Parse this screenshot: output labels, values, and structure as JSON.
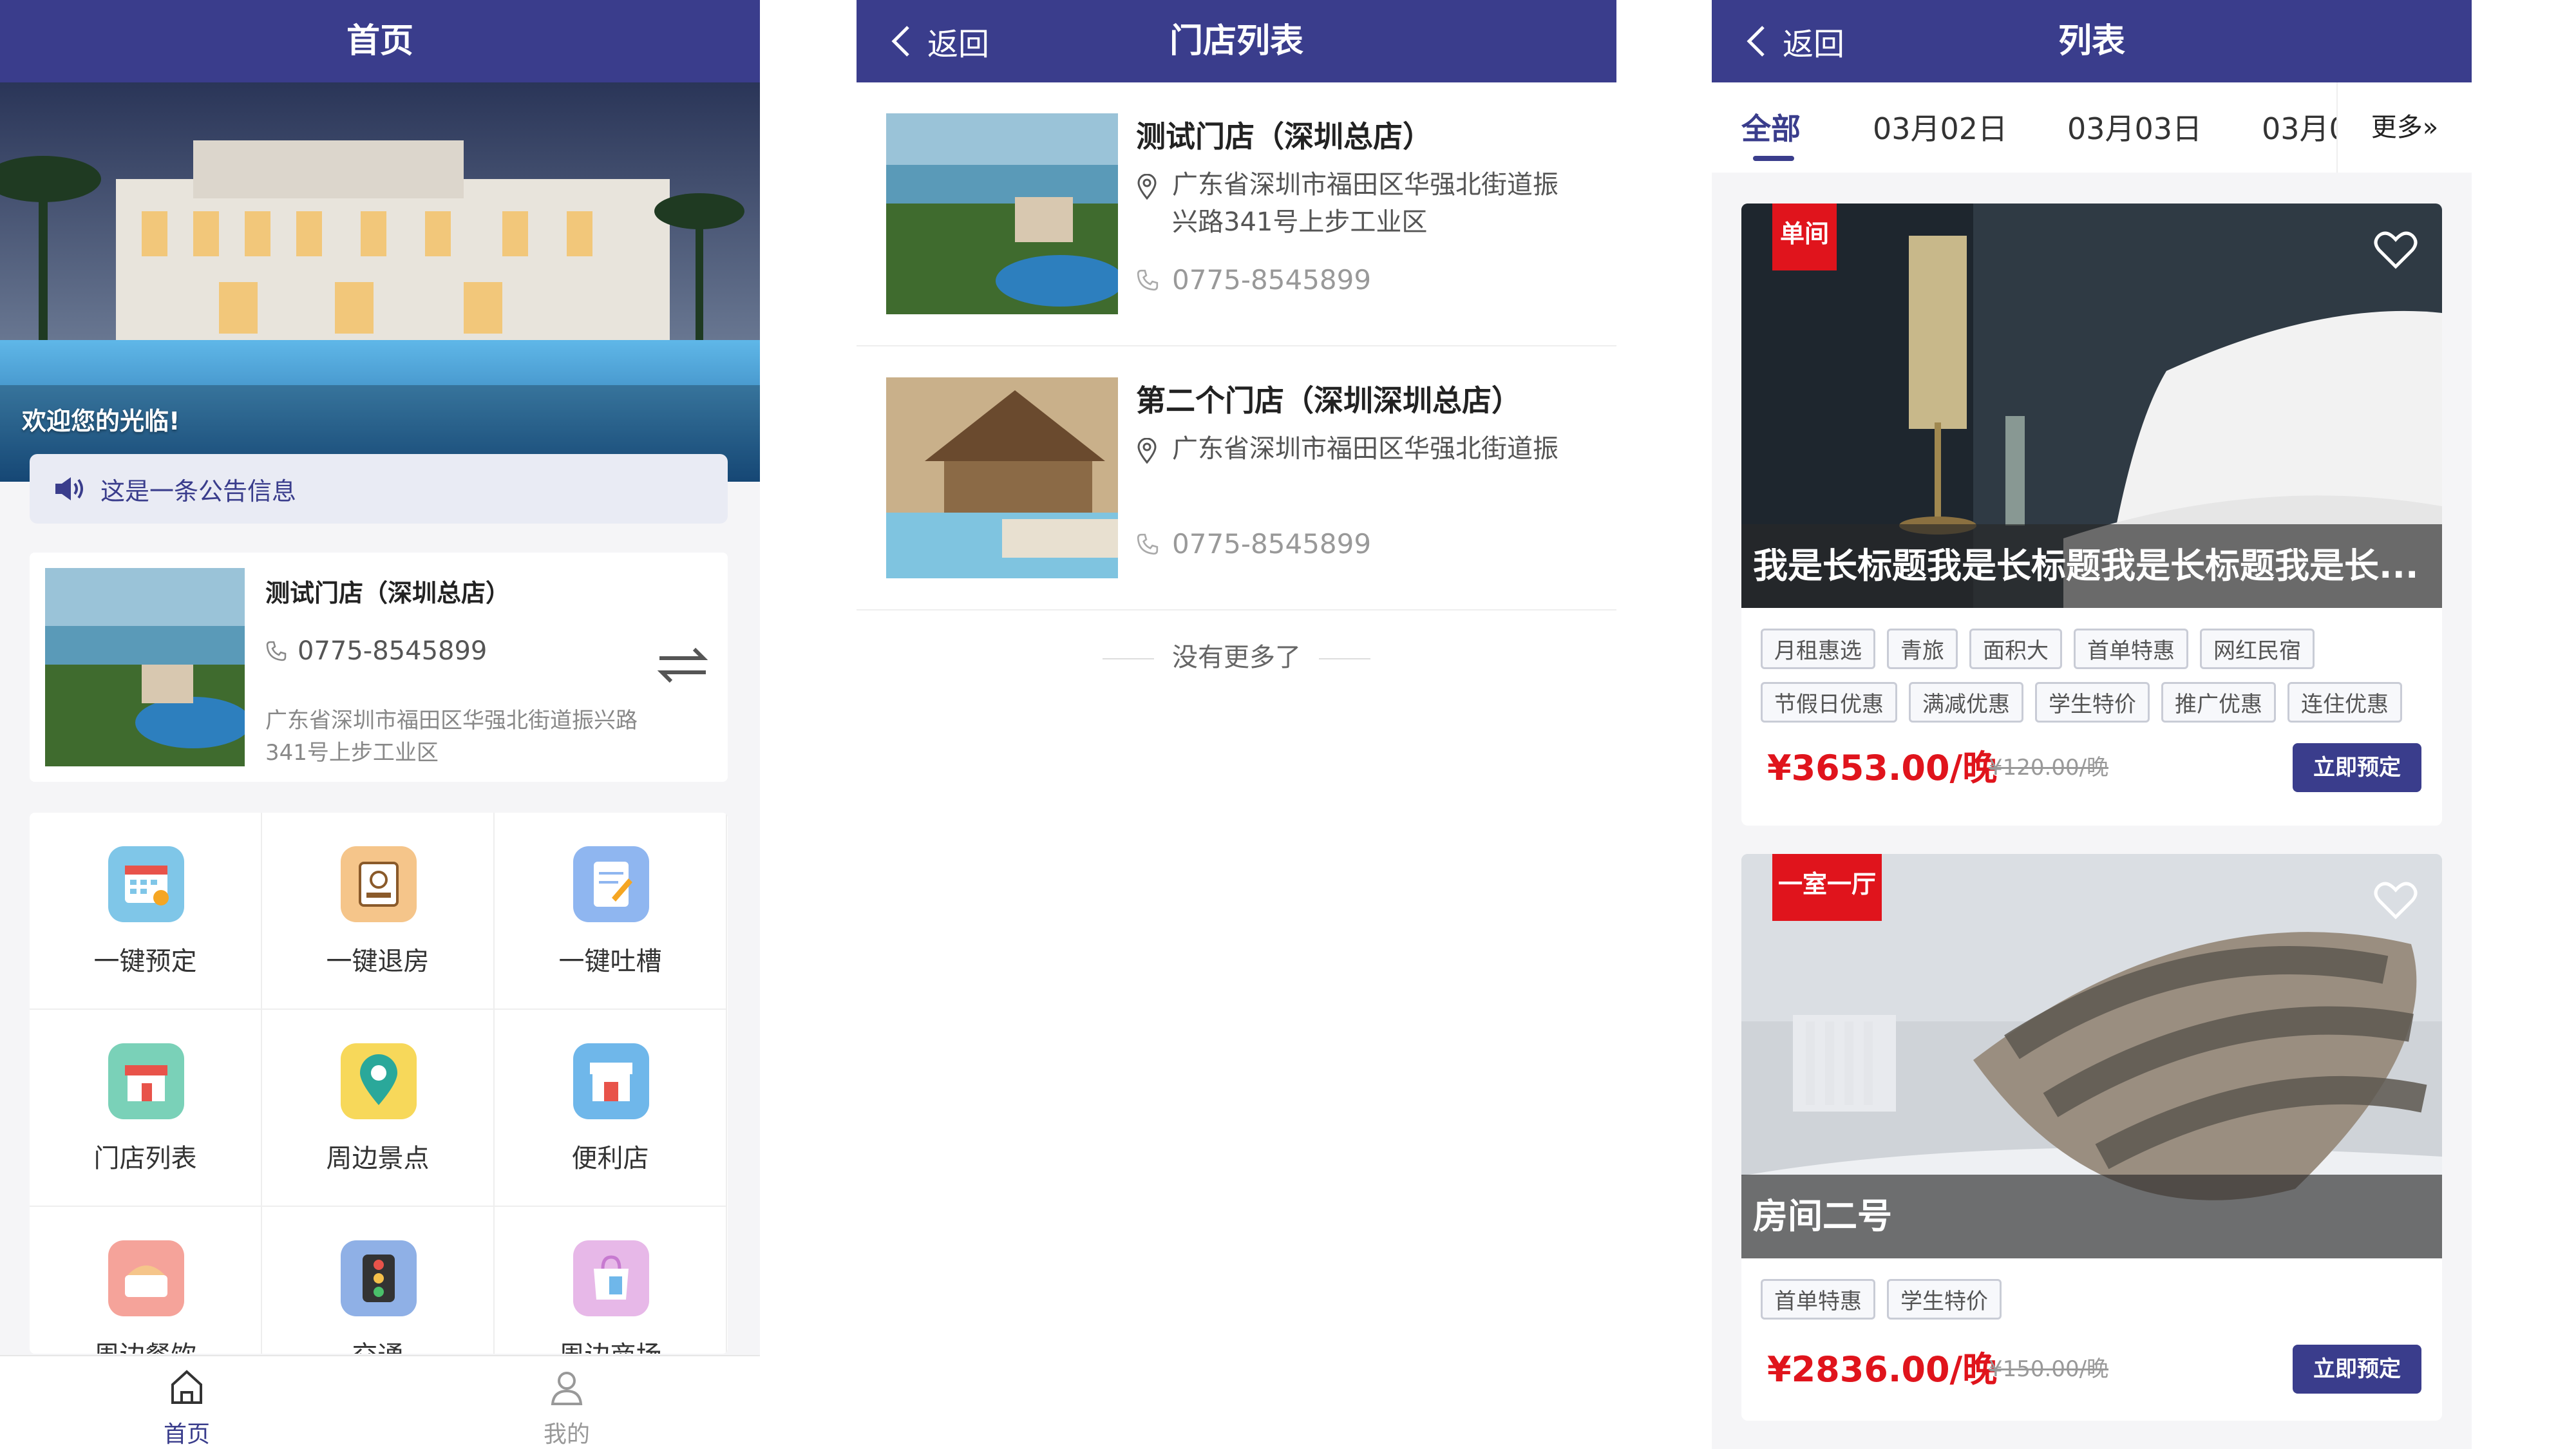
{
  "home": {
    "title": "首页",
    "welcome": "欢迎您的光临!",
    "notice": "这是一条公告信息",
    "store": {
      "name": "测试门店（深圳总店）",
      "phone": "0775-8545899",
      "address": "广东省深圳市福田区华强北街道振兴路341号上步工业区"
    },
    "grid": [
      {
        "label": "一键预定",
        "icon": "calendar-icon",
        "color": "#7fc6e8"
      },
      {
        "label": "一键退房",
        "icon": "checkout-icon",
        "color": "#f5c58a"
      },
      {
        "label": "一键吐槽",
        "icon": "feedback-icon",
        "color": "#8fb6f0"
      },
      {
        "label": "门店列表",
        "icon": "shop-icon",
        "color": "#7ad1b8"
      },
      {
        "label": "周边景点",
        "icon": "location-icon",
        "color": "#f7d85a"
      },
      {
        "label": "便利店",
        "icon": "store-icon",
        "color": "#6fb7ea"
      },
      {
        "label": "周边餐饮",
        "icon": "food-icon",
        "color": "#f5a39a"
      },
      {
        "label": "交通",
        "icon": "traffic-icon",
        "color": "#8fb0e6"
      },
      {
        "label": "周边商场",
        "icon": "shopping-icon",
        "color": "#e7b8e8"
      }
    ],
    "tabs": [
      {
        "label": "首页",
        "active": true
      },
      {
        "label": "我的",
        "active": false
      }
    ]
  },
  "store_list": {
    "back": "返回",
    "title": "门店列表",
    "items": [
      {
        "name": "测试门店（深圳总店）",
        "address": "广东省深圳市福田区华强北街道振兴路341号上步工业区",
        "phone": "0775-8545899"
      },
      {
        "name": "第二个门店（深圳深圳总店）",
        "address": "广东省深圳市福田区华强北街道振",
        "phone": "0775-8545899"
      }
    ],
    "no_more": "没有更多了"
  },
  "room_list": {
    "back": "返回",
    "title": "列表",
    "date_tabs": [
      "全部",
      "03月02日",
      "03月03日",
      "03月0"
    ],
    "more": "更多»",
    "rooms": [
      {
        "ribbon": "单间",
        "title": "我是长标题我是长标题我是长标题我是长...",
        "tags": [
          "月租惠选",
          "青旅",
          "面积大",
          "首单特惠",
          "网红民宿",
          "节假日优惠",
          "满减优惠",
          "学生特价",
          "推广优惠",
          "连住优惠"
        ],
        "price": "¥3653.00/晚",
        "old_price": "¥120.00/晚",
        "book": "立即预定"
      },
      {
        "ribbon": "一室一厅",
        "title": "房间二号",
        "tags": [
          "首单特惠",
          "学生特价"
        ],
        "price": "¥2836.00/晚",
        "old_price": "¥150.00/晚",
        "book": "立即预定"
      }
    ]
  },
  "colors": {
    "primary": "#3a3d8c",
    "price_red": "#e0141c"
  }
}
